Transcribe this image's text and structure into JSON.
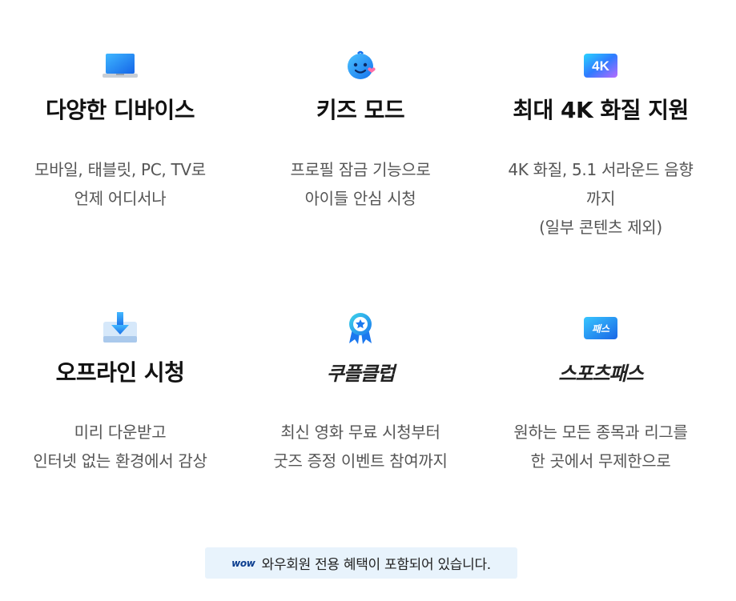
{
  "features": [
    {
      "key": "devices",
      "icon": "laptop-icon",
      "title": "다양한 디바이스",
      "lines": [
        "모바일, 태블릿, PC, TV로",
        "언제 어디서나"
      ]
    },
    {
      "key": "kids",
      "icon": "baby-face-icon",
      "title": "키즈 모드",
      "lines": [
        "프로필 잠금 기능으로",
        "아이들 안심 시청"
      ]
    },
    {
      "key": "4k",
      "icon": "4k-badge-icon",
      "icon_text": "4K",
      "title": "최대 4K 화질 지원",
      "lines": [
        "4K 화질, 5.1 서라운드 음향",
        "까지",
        "(일부 콘텐츠 제외)"
      ]
    },
    {
      "key": "offline",
      "icon": "download-tray-icon",
      "title": "오프라인 시청",
      "lines": [
        "미리 다운받고",
        "인터넷 없는 환경에서 감상"
      ]
    },
    {
      "key": "club",
      "icon": "award-ribbon-icon",
      "title": "쿠플클럽",
      "lines": [
        "최신 영화 무료 시청부터",
        "굿즈 증정 이벤트 참여까지"
      ]
    },
    {
      "key": "sports",
      "icon": "pass-badge-icon",
      "icon_text": "패스",
      "title": "스포츠패스",
      "lines": [
        "원하는 모든 종목과 리그를",
        "한 곳에서 무제한으로"
      ]
    }
  ],
  "banner": {
    "wow_label": "wow",
    "text": "와우회원 전용 혜택이 포함되어 있습니다."
  },
  "colors": {
    "accent": "#0b7cf2",
    "banner_bg": "#e8f3fc",
    "desc": "#555555"
  }
}
